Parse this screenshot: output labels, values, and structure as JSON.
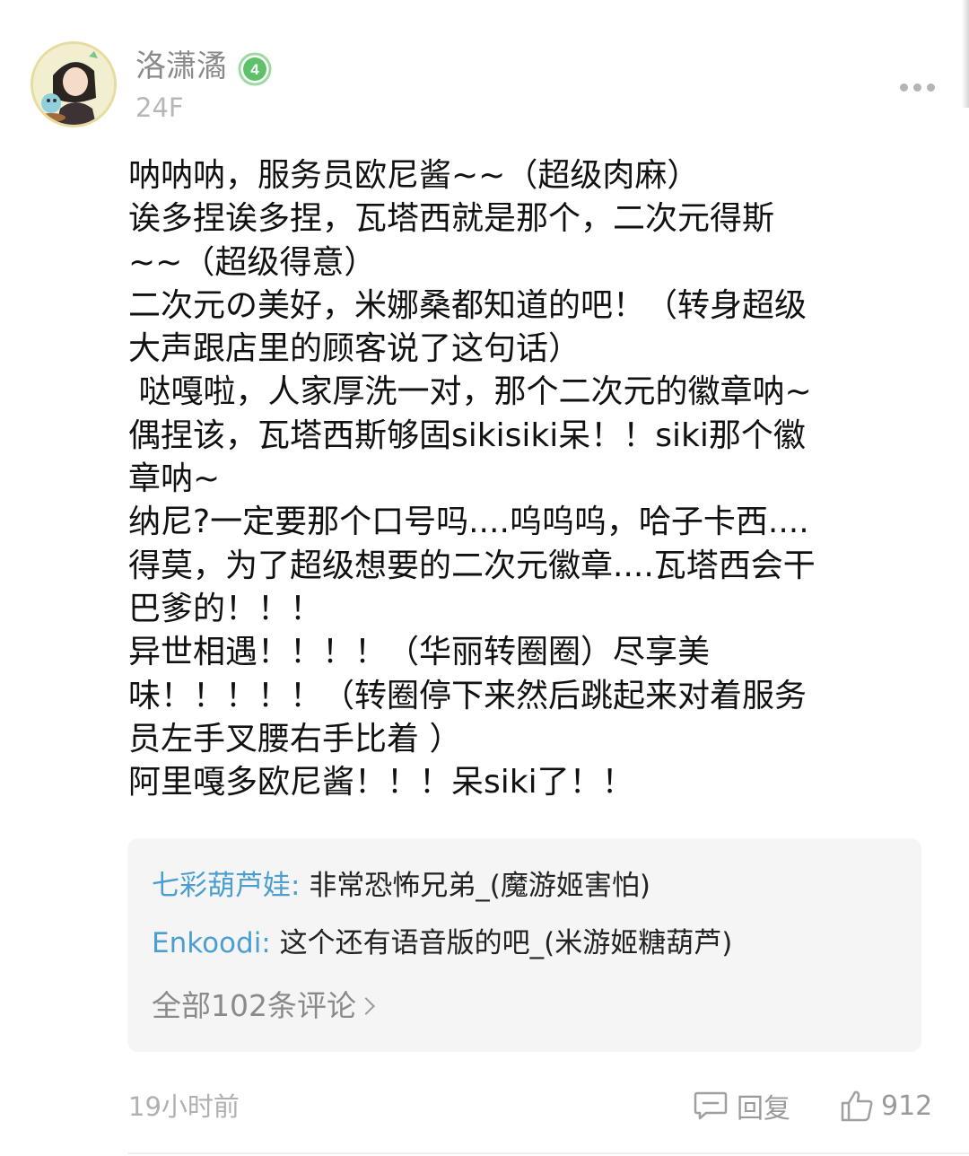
{
  "post": {
    "username": "洛潇潏",
    "level": "4",
    "floor": "24F",
    "body_lines": [
      "呐呐呐，服务员欧尼酱~~（超级肉麻）",
      "诶多捏诶多捏，瓦塔西就是那个，二次元得斯",
      "~~（超级得意）",
      "二次元の美好，米娜桑都知道的吧！（转身超级",
      "大声跟店里的顾客说了这句话）",
      " 哒嘎啦，人家厚洗一对，那个二次元的徽章呐~",
      "偶捏该，瓦塔西斯够固sikisiki呆！！siki那个徽",
      "章呐~",
      "纳尼?一定要那个口号吗....呜呜呜，哈子卡西....",
      "得莫，为了超级想要的二次元徽章....瓦塔西会干",
      "巴爹的！！！",
      "异世相遇！！！！（华丽转圈圈）尽享美",
      "味！！！！！（转圈停下来然后跳起来对着服务",
      "员左手叉腰右手比着 ）",
      "阿里嘎多欧尼酱！！！呆siki了！！"
    ],
    "time": "19小时前",
    "reply_label": "回复",
    "like_count": "912"
  },
  "comments": [
    {
      "name": "七彩葫芦娃:",
      "text": "非常恐怖兄弟_(魔游姬害怕)"
    },
    {
      "name": "Enkoodi:",
      "text": "这个还有语音版的吧_(米游姬糖葫芦)"
    }
  ],
  "all_comments_label": "全部102条评论",
  "colors": {
    "comment_name": "#4a9fd0",
    "level_badge": "#5fc26a",
    "muted": "#9a9a9a"
  },
  "icons": [
    "more-icon",
    "level-badge-icon",
    "reply-icon",
    "like-icon",
    "chevron-right-icon"
  ]
}
